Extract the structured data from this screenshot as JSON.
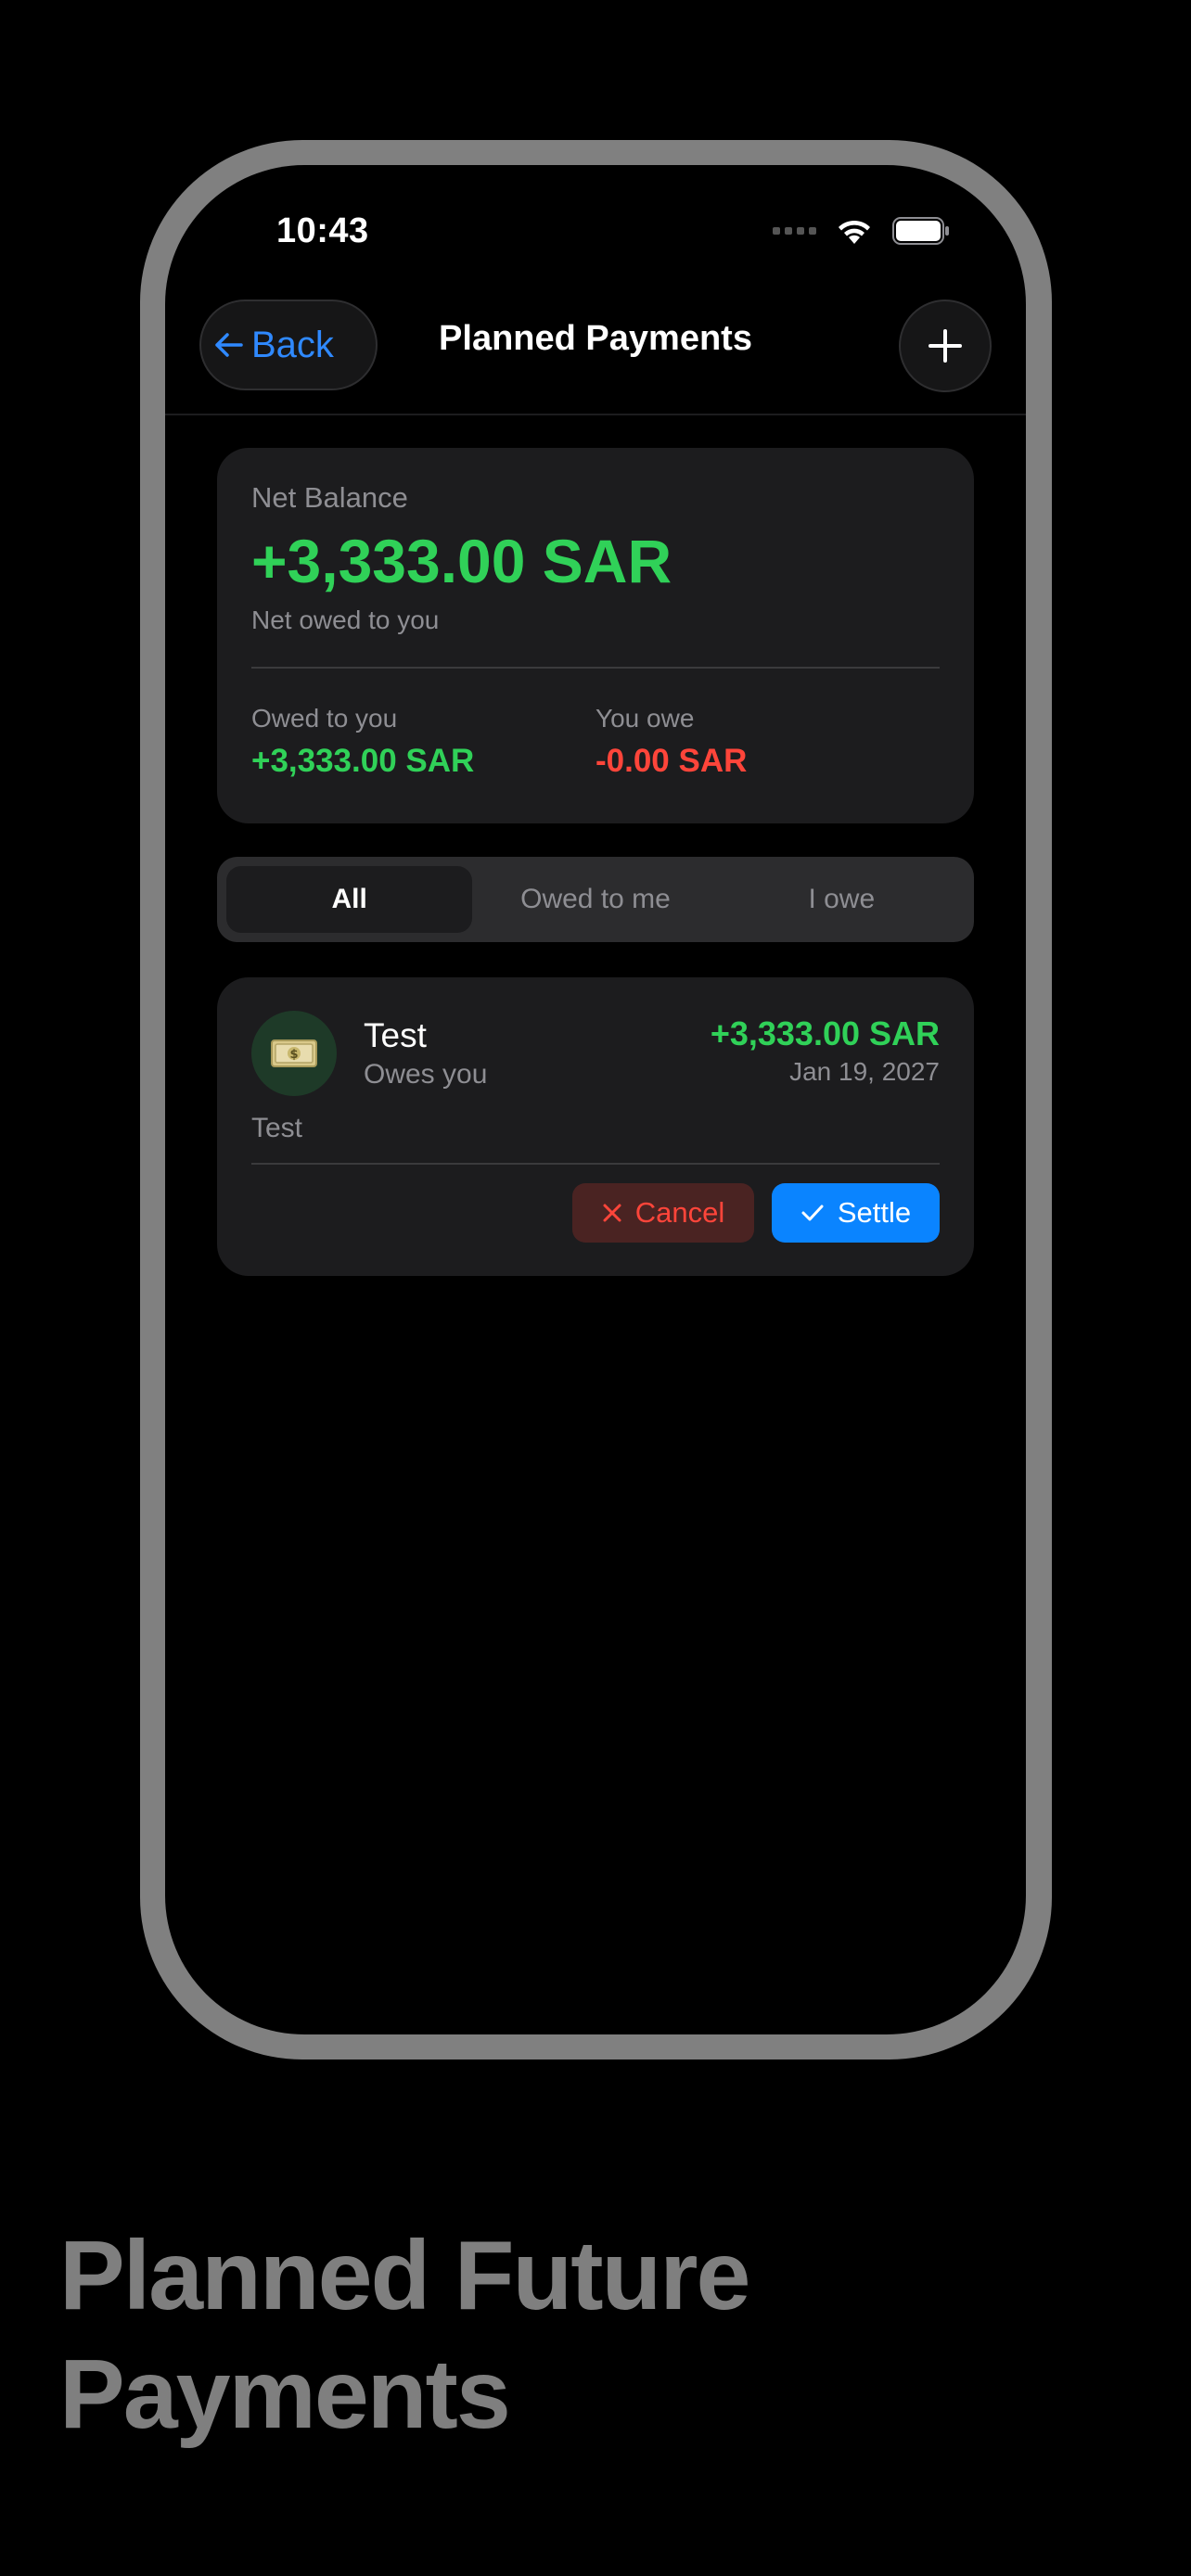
{
  "status_bar": {
    "time": "10:43"
  },
  "nav": {
    "back_label": "Back",
    "title": "Planned Payments"
  },
  "balance": {
    "label": "Net Balance",
    "amount": "+3,333.00 SAR",
    "subtitle": "Net owed to you",
    "owed_to_you_label": "Owed to you",
    "owed_to_you_value": "+3,333.00 SAR",
    "you_owe_label": "You owe",
    "you_owe_value": "-0.00 SAR"
  },
  "filter": {
    "options": [
      "All",
      "Owed to me",
      "I owe"
    ],
    "selected": "All"
  },
  "payments": [
    {
      "name": "Test",
      "status": "Owes you",
      "amount": "+3,333.00 SAR",
      "date": "Jan 19, 2027",
      "note": "Test",
      "icon": "money-icon",
      "cancel_label": "Cancel",
      "settle_label": "Settle"
    }
  ],
  "caption": {
    "line1": "Planned Future",
    "line2": "Payments"
  },
  "colors": {
    "accent_blue": "#0a84ff",
    "positive_green": "#30d158",
    "negative_red": "#ff453a",
    "card_bg": "#1c1c1e",
    "frame_gray": "#808080"
  }
}
